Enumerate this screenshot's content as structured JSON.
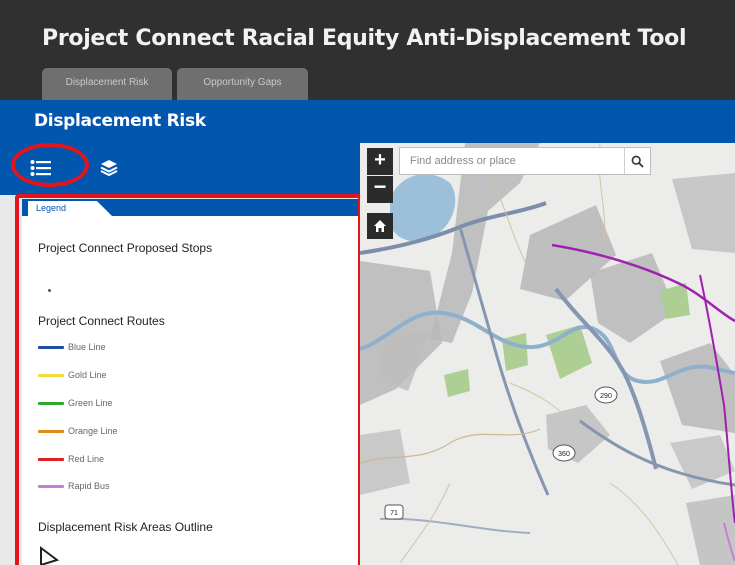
{
  "app": {
    "title": "Project Connect Racial Equity Anti-Displacement Tool"
  },
  "tabs": [
    {
      "label": "Displacement Risk"
    },
    {
      "label": "Opportunity Gaps"
    }
  ],
  "panel": {
    "title": "Displacement Risk"
  },
  "toolbar": {
    "legend_icon": "list-icon",
    "layers_icon": "layers-icon"
  },
  "legend": {
    "tab_label": "Legend",
    "stops_title": "Project Connect Proposed Stops",
    "routes_title": "Project Connect Routes",
    "routes": [
      {
        "label": "Blue Line",
        "color": "#1f4fa3"
      },
      {
        "label": "Gold Line",
        "color": "#f5dc3a"
      },
      {
        "label": "Green Line",
        "color": "#2fa82f"
      },
      {
        "label": "Orange Line",
        "color": "#e08a18"
      },
      {
        "label": "Red Line",
        "color": "#e02020"
      },
      {
        "label": "Rapid Bus",
        "color": "#c67fd8"
      }
    ],
    "outline_title": "Displacement Risk Areas Outline"
  },
  "map": {
    "search_placeholder": "Find address or place",
    "zoom_in": "+",
    "zoom_out": "−",
    "shields": [
      "71",
      "290",
      "360"
    ]
  },
  "colors": {
    "header_bg": "#303030",
    "accent_blue": "#0356ad",
    "annotation_red": "#e3141c",
    "rapid_bus_route": "#a020b0"
  }
}
